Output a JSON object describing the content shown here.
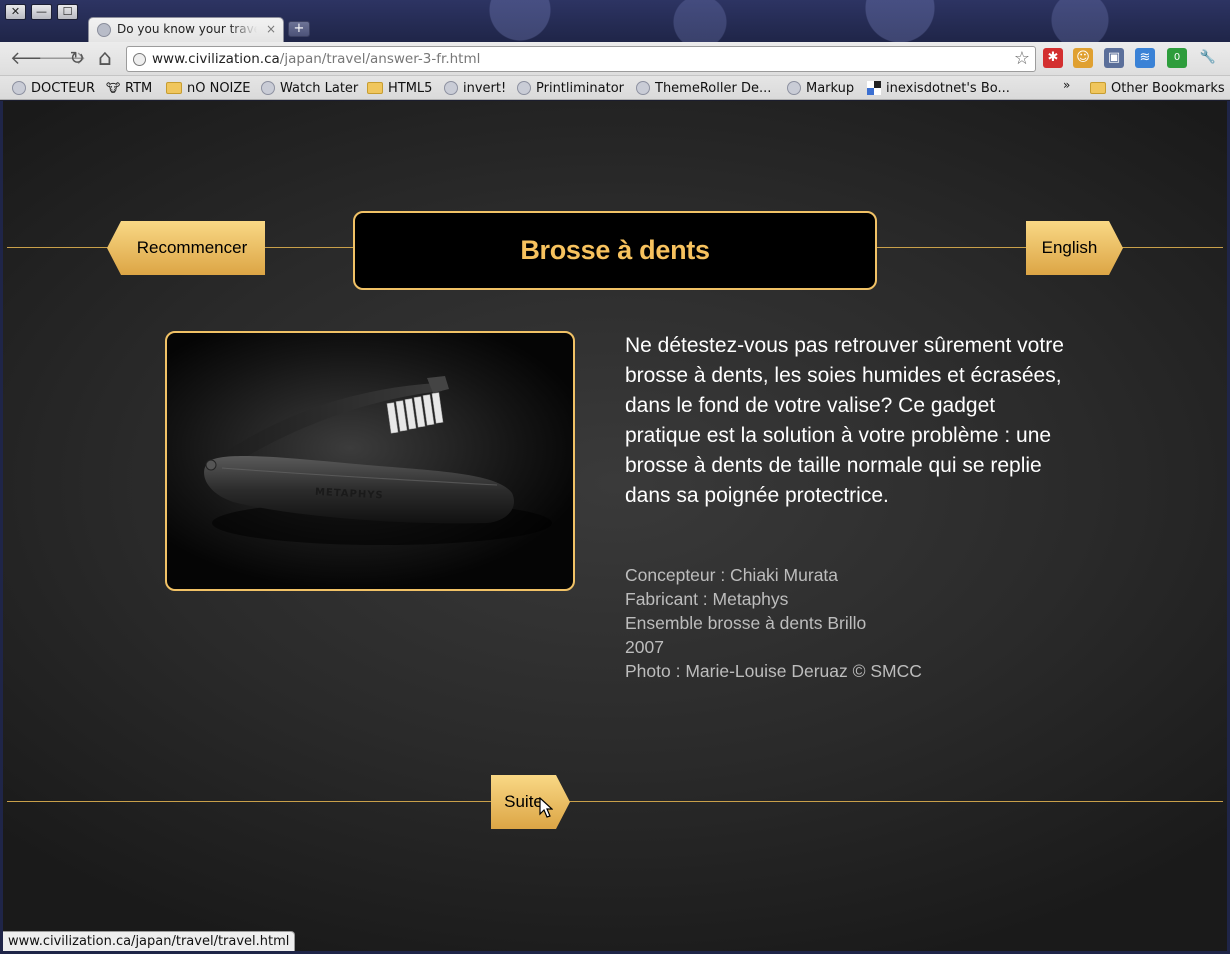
{
  "window": {
    "close_glyph": "✕",
    "minimize_glyph": "—",
    "maximize_glyph": "☐"
  },
  "tab": {
    "title": "Do you know your travel g",
    "close_glyph": "×",
    "new_tab_glyph": "+"
  },
  "toolbar": {
    "back_glyph": "🡐",
    "forward_glyph": "🡒",
    "reload_glyph": "↻",
    "home_glyph": "⌂",
    "url_domain": "www.civilization.ca",
    "url_path": "/japan/travel/answer-3-fr.html",
    "bookmark_star": "☆",
    "extensions": [
      {
        "name": "lastpass-icon",
        "glyph": "✱",
        "color": "#d32f2f"
      },
      {
        "name": "face-icon",
        "glyph": "☺",
        "color": "#e0a030"
      },
      {
        "name": "window-icon",
        "glyph": "▣",
        "color": "#5b6f9a"
      },
      {
        "name": "feed-icon",
        "glyph": "≋",
        "color": "#3a82d6"
      },
      {
        "name": "badge-icon",
        "glyph": "0",
        "color": "#2e9d3c"
      },
      {
        "name": "wrench-icon",
        "glyph": "🔧",
        "color": "#666666"
      }
    ]
  },
  "bookmarks": {
    "items": [
      {
        "label": "DOCTEUR",
        "icon": "globe"
      },
      {
        "label": "RTM",
        "icon": "cow"
      },
      {
        "label": "nO NOIZE",
        "icon": "folder"
      },
      {
        "label": "Watch Later",
        "icon": "globe"
      },
      {
        "label": "HTML5",
        "icon": "folder"
      },
      {
        "label": "invert!",
        "icon": "globe"
      },
      {
        "label": "Printliminator",
        "icon": "globe"
      },
      {
        "label": "ThemeRoller De...",
        "icon": "globe"
      },
      {
        "label": "Markup",
        "icon": "globe"
      },
      {
        "label": "inexisdotnet's Bo...",
        "icon": "squares"
      }
    ],
    "overflow_glyph": "»",
    "other": "Other Bookmarks"
  },
  "page": {
    "restart_label": "Recommencer",
    "title": "Brosse à dents",
    "english_label": "English",
    "description": "Ne détestez-vous pas retrouver sûrement votre brosse à dents, les soies humides et écrasées, dans le fond de votre valise? Ce gadget pratique est la solution à votre problème : une brosse à dents de taille normale qui se replie dans sa poignée protectrice.",
    "credits": [
      "Concepteur : Chiaki Murata",
      "Fabricant : Metaphys",
      "Ensemble brosse à dents Brillo",
      "2007",
      "Photo : Marie-Louise Deruaz © SMCC"
    ],
    "product_brand": "METAPHYS",
    "next_label": "Suite"
  },
  "statusbar": {
    "text": "www.civilization.ca/japan/travel/travel.html"
  },
  "colors": {
    "accent_gold": "#f7c25e",
    "button_gold": "#f9d885",
    "page_bg": "#2a2a2a"
  }
}
